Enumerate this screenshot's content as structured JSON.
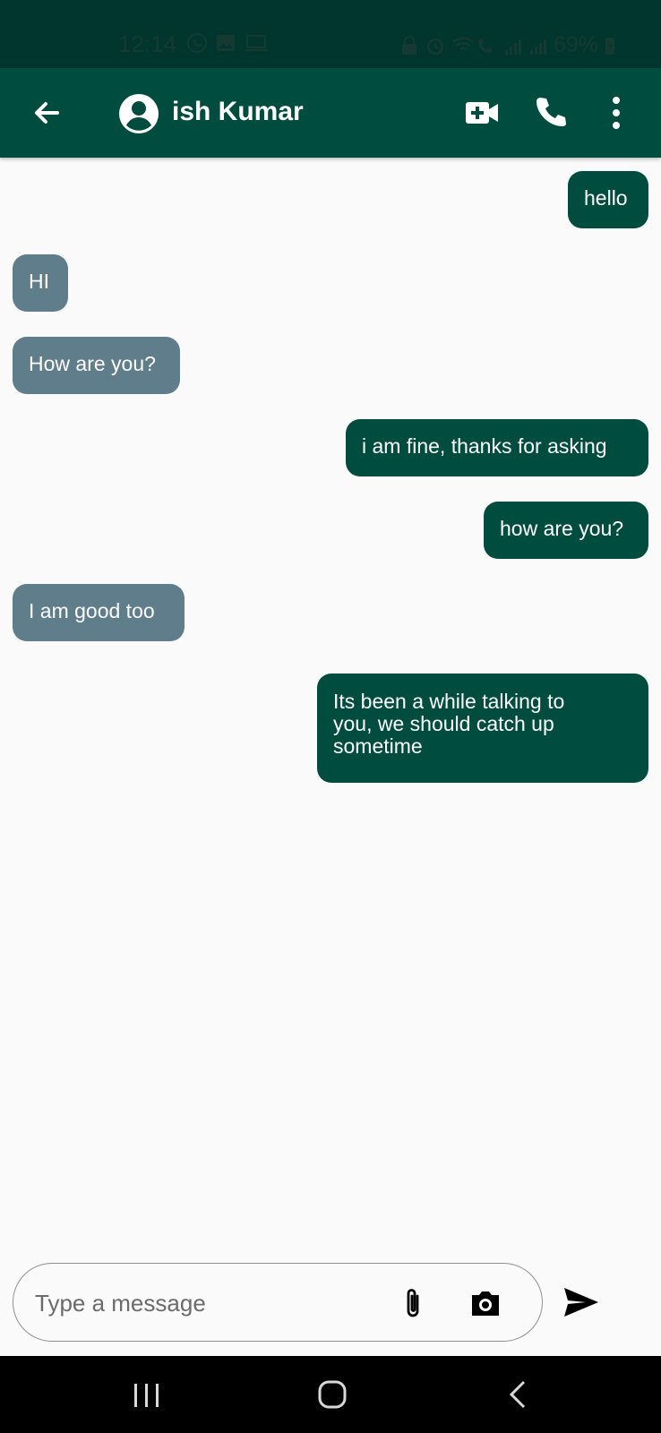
{
  "status_bar": {
    "time": "12:14",
    "battery": "69%",
    "left_icons": [
      "whatsapp-icon",
      "gallery-icon",
      "laptop-icon"
    ],
    "right_icons": [
      "lock-icon",
      "alarm-icon",
      "wifi-calling-icon",
      "signal-icon",
      "signal-icon",
      "battery-icon"
    ]
  },
  "app_bar": {
    "contact_name": "ish Kumar",
    "icons": [
      "back-arrow-icon",
      "account-circle-icon",
      "video-call-add-icon",
      "phone-icon",
      "more-vert-icon"
    ]
  },
  "messages": [
    {
      "text": "hello",
      "direction": "sent"
    },
    {
      "text": "HI",
      "direction": "received"
    },
    {
      "text": "How are you?",
      "direction": "received"
    },
    {
      "text": "i am fine, thanks for asking",
      "direction": "sent"
    },
    {
      "text": "how are you?",
      "direction": "sent"
    },
    {
      "text": "I am good too",
      "direction": "received"
    },
    {
      "text": "Its been a while talking to\nyou, we should catch up\nsometime",
      "direction": "sent"
    }
  ],
  "composer": {
    "placeholder": "Type a message",
    "value": ""
  },
  "colors": {
    "status_bar": "#00362d",
    "app_bar": "#004d40",
    "sent_bubble": "#004d40",
    "received_bubble": "#607d8b",
    "background": "#fafafa"
  }
}
